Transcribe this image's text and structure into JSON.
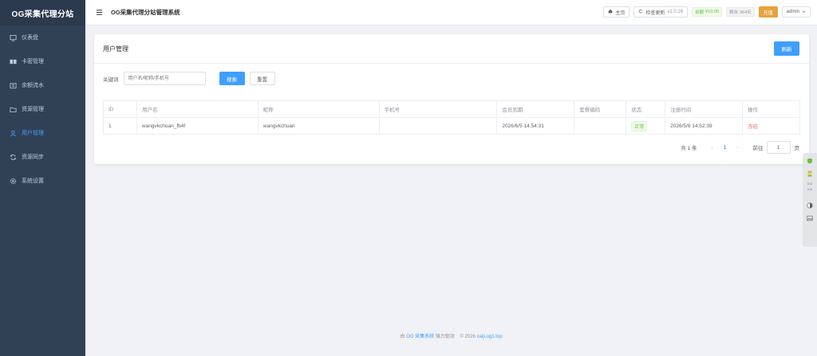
{
  "sidebar": {
    "title": "OG采集代理分站",
    "items": [
      {
        "label": "仪表盘",
        "icon": "dashboard-icon",
        "active": false
      },
      {
        "label": "卡密管理",
        "icon": "card-icon",
        "active": false
      },
      {
        "label": "余额流水",
        "icon": "wallet-icon",
        "active": false
      },
      {
        "label": "资源管理",
        "icon": "folder-icon",
        "active": false
      },
      {
        "label": "用户管理",
        "icon": "user-icon",
        "active": true
      },
      {
        "label": "资源同步",
        "icon": "sync-icon",
        "active": false
      },
      {
        "label": "系统设置",
        "icon": "gear-icon",
        "active": false
      }
    ]
  },
  "topbar": {
    "title": "OG采集代理分站管理系统",
    "home_label": "主页",
    "update_label": "检查更新",
    "version": "v1.0.16",
    "balance_label": "余额",
    "balance_value": "¥10.00",
    "remain_label": "剩余",
    "remain_value": "364天",
    "recharge_label": "充值",
    "user_label": "admin"
  },
  "card": {
    "title": "用户管理",
    "refresh_label": "刷新",
    "filter_label": "关键词",
    "search_placeholder": "用户名/昵称/手机号",
    "search_button": "搜索",
    "reset_button": "重置"
  },
  "table": {
    "headers": [
      "ID",
      "用户名",
      "昵称",
      "手机号",
      "会员到期",
      "套餐编码",
      "状态",
      "注册时间",
      "操作"
    ],
    "rows": [
      {
        "id": "1",
        "username": "wangvkchuan_fb4f",
        "nickname": "wangvkchuan",
        "phone": "",
        "expire": "2026/6/5 14:54:31",
        "plan_code": "",
        "status": "正常",
        "register_time": "2026/5/6 14:52:39",
        "action": "冻结"
      }
    ]
  },
  "pagination": {
    "total_text": "共 1 条",
    "current_page": "1",
    "goto_label": "前往",
    "goto_value": "1",
    "unit": "页"
  },
  "footer": {
    "prefix": "由",
    "brand": "OG 采集系统",
    "powered": "强力驱动",
    "copyright": "© 2026",
    "site": "caiji.og1.top"
  },
  "floatbar": {
    "items": [
      "0.2",
      "0.4"
    ]
  },
  "colors": {
    "sidebar_bg": "#304156",
    "accent": "#409eff",
    "warning": "#e6a23c",
    "success": "#67c23a",
    "danger": "#f56c6c"
  }
}
